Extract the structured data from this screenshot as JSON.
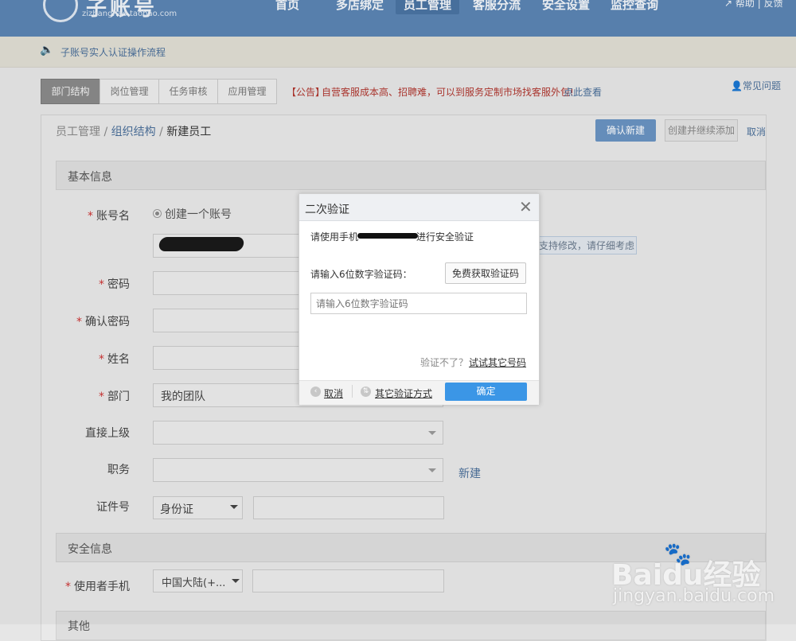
{
  "header": {
    "logo_text": "子账号",
    "logo_sub": "zizhanghao.taobao.com",
    "nav": [
      "首页",
      "多店绑定",
      "员工管理",
      "客服分流",
      "安全设置",
      "监控查询"
    ],
    "links": "帮助 | 反馈"
  },
  "notice": {
    "link": "子账号实人认证操作流程"
  },
  "tabs": [
    "部门结构",
    "岗位管理",
    "任务审核",
    "应用管理"
  ],
  "announce": {
    "tag": "【公告】",
    "text": "自营客服成本高、招聘难，可以到服务定制市场找客服外包!",
    "link": "点此查看"
  },
  "faq": "常见问题",
  "breadcrumb": {
    "a": "员工管理",
    "sep": " / ",
    "b": "组织结构",
    "c": "新建员工"
  },
  "buttons": {
    "confirm": "确认新建",
    "create_continue": "创建并继续添加",
    "cancel": "取消"
  },
  "basic_section": "基本信息",
  "form": {
    "account_label": "账号名",
    "create_radio": "创建一个账号",
    "hint": "支持修改，请仔细考虑",
    "password_label": "密码",
    "confirm_password_label": "确认密码",
    "name_label": "姓名",
    "dept_label": "部门",
    "dept_value": "我的团队",
    "superior_label": "直接上级",
    "title_label": "职务",
    "new_link": "新建",
    "id_label": "证件号",
    "id_type": "身份证"
  },
  "security_section": "安全信息",
  "phone": {
    "label": "使用者手机",
    "country": "中国大陆(+..."
  },
  "other_section": "其他",
  "modal": {
    "title": "二次验证",
    "phone_pre": "请使用手机",
    "phone_post": "进行安全验证",
    "code_label": "请输入6位数字验证码：",
    "get_code": "免费获取验证码",
    "input_placeholder": "请输入6位数字验证码",
    "fail_text": "验证不了？",
    "try_other": "试试其它号码",
    "cancel": "取消",
    "other_method": "其它验证方式",
    "ok": "确定"
  },
  "watermark": {
    "text": "Baidu经验",
    "url": "jingyan.baidu.com"
  }
}
